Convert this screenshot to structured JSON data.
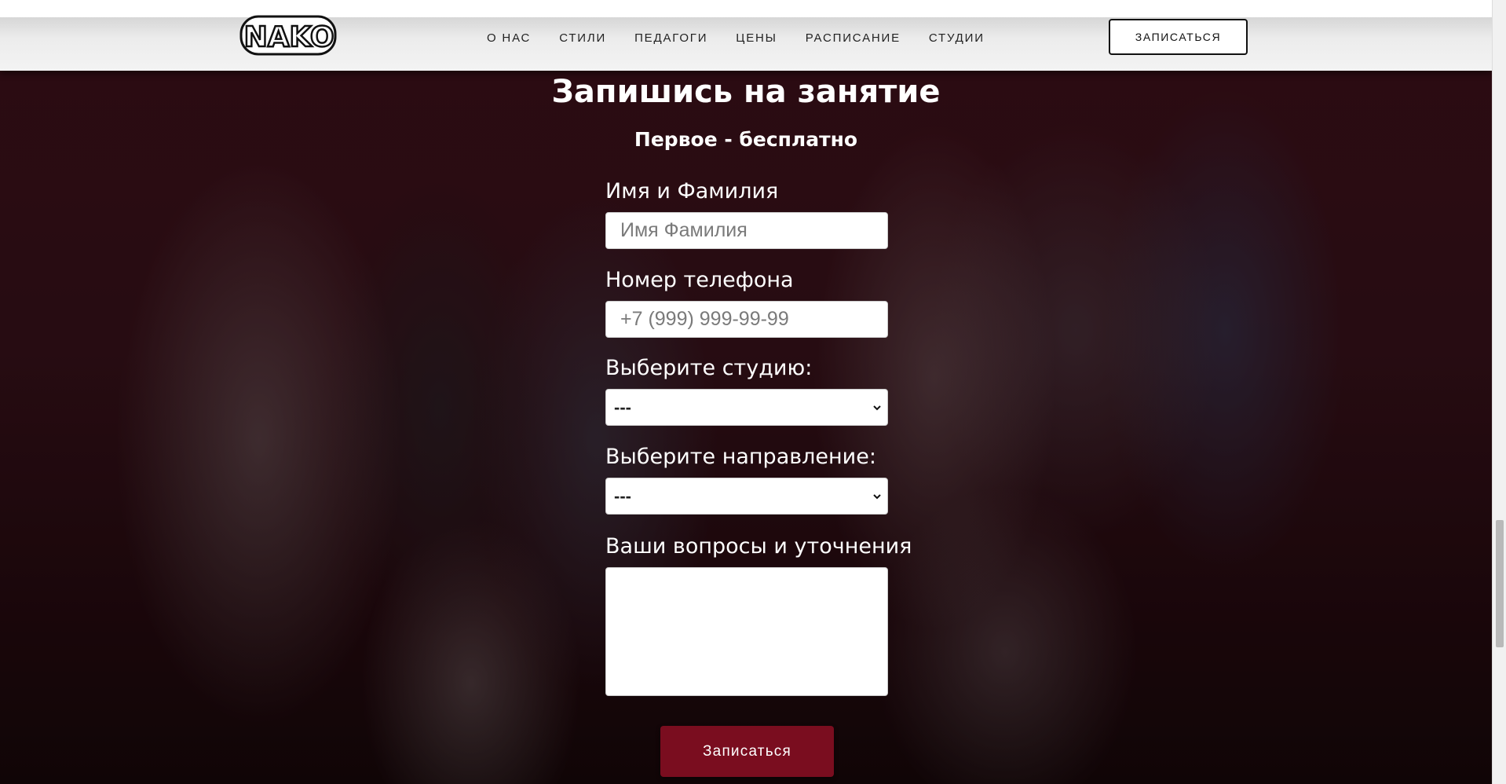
{
  "brand": {
    "logo_text": "NAKO"
  },
  "nav": {
    "items": [
      {
        "label": "О НАС"
      },
      {
        "label": "СТИЛИ"
      },
      {
        "label": "ПЕДАГОГИ"
      },
      {
        "label": "ЦЕНЫ"
      },
      {
        "label": "РАСПИСАНИЕ"
      },
      {
        "label": "СТУДИИ"
      }
    ],
    "cta_label": "ЗАПИСАТЬСЯ"
  },
  "form": {
    "title": "Запишись на занятие",
    "subtitle": "Первое - бесплатно",
    "name_label": "Имя и Фамилия",
    "name_placeholder": "Имя Фамилия",
    "phone_label": "Номер телефона",
    "phone_placeholder": "+7 (999) 999-99-99",
    "studio_label": "Выберите студию:",
    "studio_selected": "---",
    "direction_label": "Выберите направление:",
    "direction_selected": "---",
    "questions_label": "Ваши вопросы и уточнения",
    "questions_value": "",
    "submit_label": "Записаться"
  },
  "colors": {
    "accent": "#7a0d1f",
    "header_bg": "#efefef",
    "text_light": "#ffffff"
  },
  "icons": [
    "chevron-down-icon"
  ]
}
